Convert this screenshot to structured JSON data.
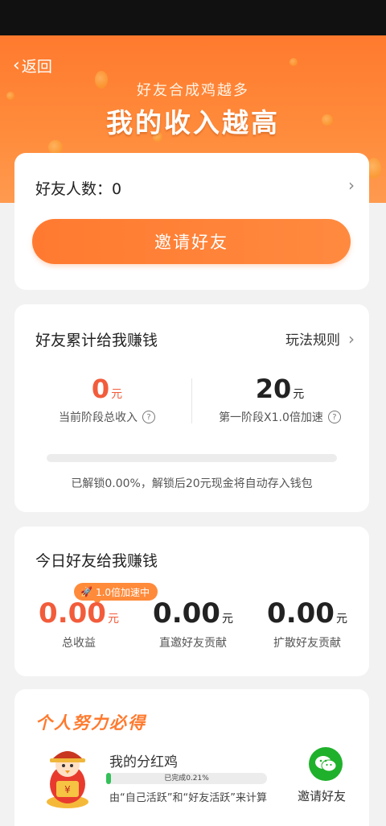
{
  "nav": {
    "back_label": "返回"
  },
  "hero": {
    "subtitle": "好友合成鸡越多",
    "title": "我的收入越高"
  },
  "friends": {
    "count_label": "好友人数：0",
    "invite_button": "邀请好友"
  },
  "earnings": {
    "title": "好友累计给我赚钱",
    "rules_label": "玩法规则",
    "current": {
      "value": "0",
      "unit": "元",
      "label": "当前阶段总收入"
    },
    "stage": {
      "value": "20",
      "unit": "元",
      "label": "第一阶段X1.0倍加速"
    },
    "progress_fraction": 0.0,
    "unlock_text": "已解锁0.00%，解锁后20元现金将自动存入钱包"
  },
  "today": {
    "title": "今日好友给我赚钱",
    "badge": "1.0倍加速中",
    "stats": [
      {
        "value": "0.00",
        "unit": "元",
        "label": "总收益"
      },
      {
        "value": "0.00",
        "unit": "元",
        "label": "直邀好友贡献"
      },
      {
        "value": "0.00",
        "unit": "元",
        "label": "扩散好友贡献"
      }
    ]
  },
  "effort": {
    "title": "个人努力必得",
    "item_title": "我的分红鸡",
    "progress_text": "已完成0.21%",
    "progress_fraction": 0.0021,
    "calc_text": "由“自己活跃”和“好友活跃”来计算",
    "share_label": "邀请好友"
  },
  "colors": {
    "accent": "#ff7a2e",
    "value_red": "#f25c3b",
    "wechat": "#1fb12b"
  }
}
